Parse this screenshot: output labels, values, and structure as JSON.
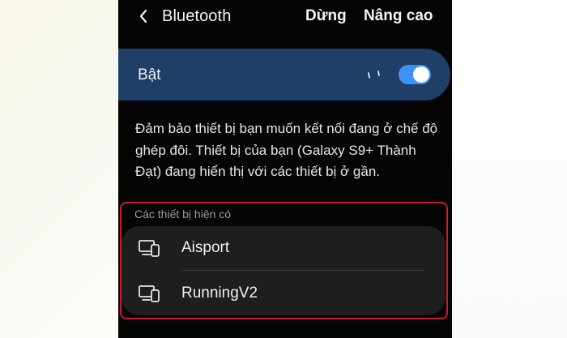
{
  "header": {
    "title": "Bluetooth",
    "stop_label": "Dừng",
    "advanced_label": "Nâng cao"
  },
  "bluetooth": {
    "label": "Bật",
    "enabled": true,
    "toggle_color": "#3e91f7"
  },
  "description": "Đảm bảo thiết bị bạn muốn kết nối đang ở chế độ ghép đôi. Thiết bị của bạn (Galaxy S9+ Thành Đạt) đang hiển thị với các thiết bị ở gần.",
  "available": {
    "section_label": "Các thiết bị hiện có",
    "highlight_color": "#c81e2a",
    "devices": [
      {
        "name": "Aisport",
        "icon": "devices-icon"
      },
      {
        "name": "RunningV2",
        "icon": "devices-icon"
      }
    ]
  }
}
